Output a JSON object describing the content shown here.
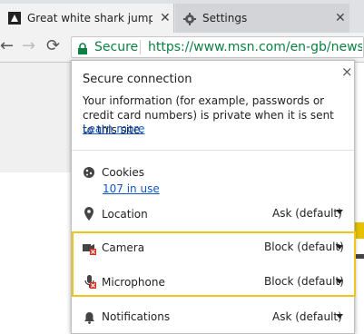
{
  "tabs": [
    {
      "title": "Great white shark jumps",
      "close": "✕"
    },
    {
      "title": "Settings",
      "close": "✕"
    }
  ],
  "omnibox": {
    "security_label": "Secure",
    "url": "https://www.msn.com/en-gb/news/off"
  },
  "popup": {
    "close": "×",
    "title": "Secure connection",
    "description": "Your information (for example, passwords or credit card numbers) is private when it is sent to this site.",
    "learn_more": "Learn more",
    "cookies": {
      "label": "Cookies",
      "link": "107 in use"
    },
    "permissions": [
      {
        "label": "Location",
        "value": "Ask (default)",
        "icon": "location-pin-icon"
      },
      {
        "label": "Camera",
        "value": "Block (default)",
        "icon": "camera-blocked-icon"
      },
      {
        "label": "Microphone",
        "value": "Block (default)",
        "icon": "microphone-blocked-icon"
      },
      {
        "label": "Notifications",
        "value": "Ask (default)",
        "icon": "bell-icon"
      }
    ]
  },
  "colors": {
    "secure_green": "#0b8043",
    "link_blue": "#1155cc",
    "highlight": "#f0c419",
    "blocked_red": "#d93025"
  }
}
